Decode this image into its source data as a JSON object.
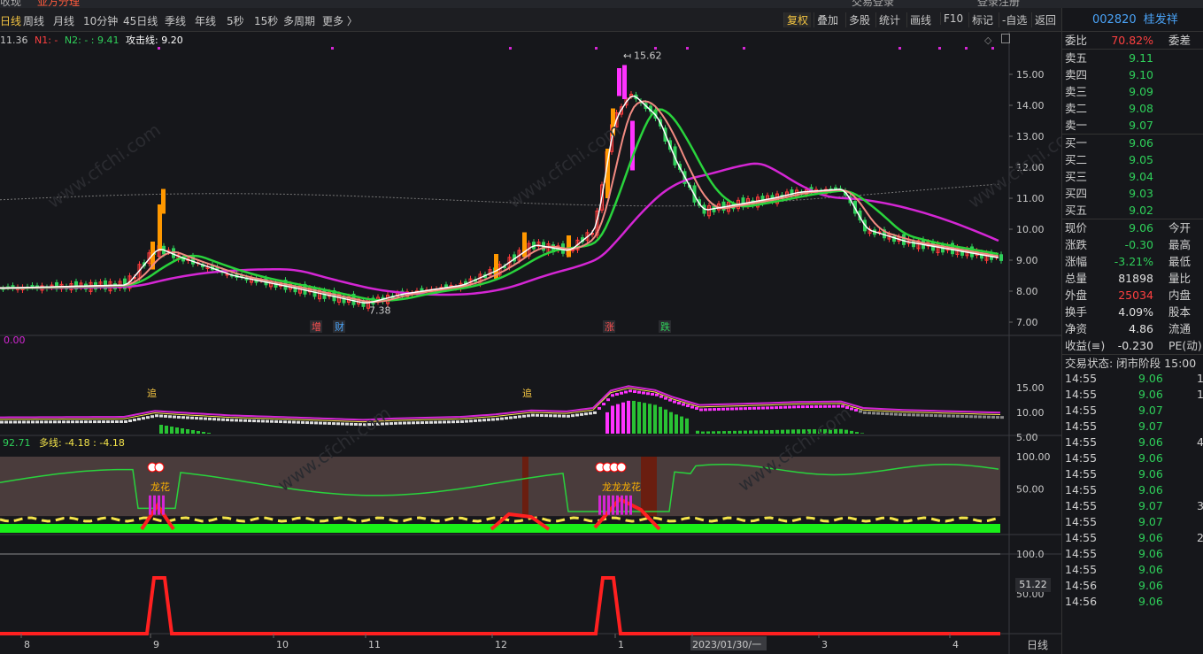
{
  "top_strip": {
    "left": "收现",
    "app_title": "亚方分理",
    "center": "交易登录",
    "login": "登录注册"
  },
  "toolbar": {
    "period_items": [
      "日线",
      "周线",
      "月线",
      "10分钟",
      "45日线",
      "季线",
      "年线",
      "5秒",
      "15秒",
      "多周期",
      "更多 〉"
    ],
    "active_period": "日线",
    "right_items": [
      "复权",
      "叠加",
      "多股",
      "统计",
      "画线",
      "F10",
      "标记",
      "-自选",
      "返回"
    ],
    "highlight_right": "复权"
  },
  "main_chart": {
    "legend": {
      "prefix": "11.36",
      "n1": "N1: -",
      "n2": "N2: - : 9.41",
      "attack_label": "攻击线: 9.20"
    },
    "y_ticks": [
      "15.00",
      "14.00",
      "13.00",
      "12.00",
      "11.00",
      "10.00",
      "9.00",
      "8.00",
      "7.00"
    ],
    "high_label": "15.62",
    "low_label": "7.38",
    "event_marks": [
      {
        "text": "增",
        "color": "#ff5050"
      },
      {
        "text": "财",
        "color": "#4aa3f7"
      },
      {
        "text": "涨",
        "color": "#ff5050"
      },
      {
        "text": "跌",
        "color": "#2fd05a"
      }
    ]
  },
  "indicator1": {
    "label": "0.00",
    "y_ticks": [
      "15.00",
      "10.00",
      "5.00"
    ],
    "marks": [
      "追",
      "追"
    ]
  },
  "indicator2": {
    "label_prefix": "92.71",
    "label_main": "多线: -4.18 : -4.18",
    "y_ticks": [
      "100.00",
      "50.00"
    ],
    "marks": [
      "龙花",
      "龙龙龙花"
    ]
  },
  "indicator3": {
    "y_ticks": [
      "100.0",
      "50.00"
    ],
    "current_value": "51.22"
  },
  "x_axis": {
    "labels": [
      "8",
      "9",
      "10",
      "11",
      "12",
      "1",
      "2023/01/30/一",
      "3",
      "4"
    ],
    "period_button": "日线"
  },
  "chart_data": {
    "type": "candlestick",
    "title": "",
    "ylim": [
      7,
      15.62
    ],
    "series": [
      {
        "name": "攻击线",
        "last": 9.2
      },
      {
        "name": "N2",
        "last": 9.41
      }
    ],
    "annotations": {
      "high": 15.62,
      "low": 7.38
    }
  },
  "quote_panel": {
    "code": "002820",
    "name": "桂发祥",
    "weibi": {
      "label": "委比",
      "value": "70.82%",
      "right": "委差"
    },
    "asks": [
      {
        "label": "卖五",
        "price": "9.11"
      },
      {
        "label": "卖四",
        "price": "9.10"
      },
      {
        "label": "卖三",
        "price": "9.09"
      },
      {
        "label": "卖二",
        "price": "9.08"
      },
      {
        "label": "卖一",
        "price": "9.07"
      }
    ],
    "bids": [
      {
        "label": "买一",
        "price": "9.06"
      },
      {
        "label": "买二",
        "price": "9.05"
      },
      {
        "label": "买三",
        "price": "9.04"
      },
      {
        "label": "买四",
        "price": "9.03"
      },
      {
        "label": "买五",
        "price": "9.02"
      }
    ],
    "stats": [
      {
        "label": "现价",
        "value": "9.06",
        "cls": "green",
        "right": "今开"
      },
      {
        "label": "涨跌",
        "value": "-0.30",
        "cls": "green",
        "right": "最高"
      },
      {
        "label": "涨幅",
        "value": "-3.21%",
        "cls": "green",
        "right": "最低"
      },
      {
        "label": "总量",
        "value": "81898",
        "cls": "white",
        "right": "量比"
      },
      {
        "label": "外盘",
        "value": "25034",
        "cls": "red",
        "right": "内盘"
      },
      {
        "label": "换手",
        "value": "4.09%",
        "cls": "white",
        "right": "股本"
      },
      {
        "label": "净资",
        "value": "4.86",
        "cls": "white",
        "right": "流通"
      },
      {
        "label": "收益(≡)",
        "value": "-0.230",
        "cls": "white",
        "right": "PE(动)"
      }
    ],
    "trade_status": "交易状态: 闭市阶段 15:00",
    "ticks": [
      {
        "time": "14:55",
        "price": "9.06",
        "extra": "1"
      },
      {
        "time": "14:55",
        "price": "9.06",
        "extra": "1"
      },
      {
        "time": "14:55",
        "price": "9.07",
        "extra": ""
      },
      {
        "time": "14:55",
        "price": "9.07",
        "extra": ""
      },
      {
        "time": "14:55",
        "price": "9.06",
        "extra": "4"
      },
      {
        "time": "14:55",
        "price": "9.06",
        "extra": ""
      },
      {
        "time": "14:55",
        "price": "9.06",
        "extra": ""
      },
      {
        "time": "14:55",
        "price": "9.06",
        "extra": ""
      },
      {
        "time": "14:55",
        "price": "9.07",
        "extra": "3"
      },
      {
        "time": "14:55",
        "price": "9.07",
        "extra": ""
      },
      {
        "time": "14:55",
        "price": "9.06",
        "extra": "2"
      },
      {
        "time": "14:55",
        "price": "9.06",
        "extra": ""
      },
      {
        "time": "14:55",
        "price": "9.06",
        "extra": ""
      },
      {
        "time": "14:56",
        "price": "9.06",
        "extra": ""
      },
      {
        "time": "14:56",
        "price": "9.06",
        "extra": ""
      }
    ]
  },
  "colors": {
    "up": "#ff3b3b",
    "down": "#2fd05a",
    "ma_white": "#ffffff",
    "ma_red": "#ff2a2a",
    "ma_green": "#29d33c",
    "ma_magenta": "#d426d4",
    "accent": "#f4c542"
  }
}
